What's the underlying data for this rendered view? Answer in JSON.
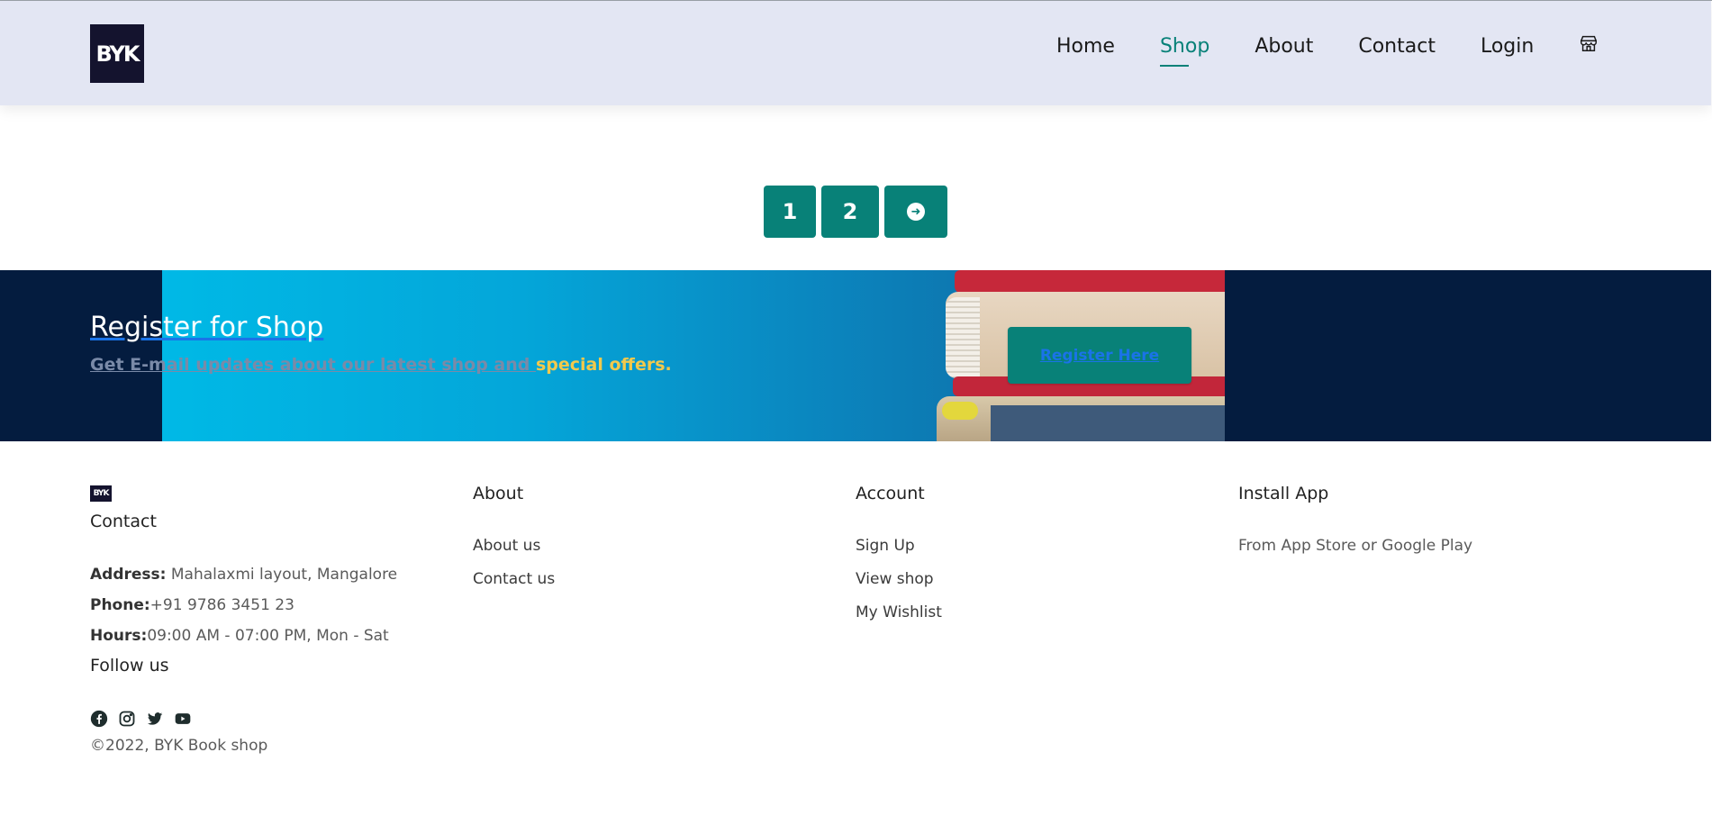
{
  "header": {
    "logo_text": "BYK",
    "nav": [
      {
        "label": "Home"
      },
      {
        "label": "Shop"
      },
      {
        "label": "About"
      },
      {
        "label": "Contact"
      },
      {
        "label": "Login"
      }
    ],
    "bag_icon": "storefront-icon"
  },
  "pagination": {
    "pages": [
      "1",
      "2"
    ],
    "next_icon": "arrow-right-circle-icon"
  },
  "newsletter": {
    "title": "Register for Shop",
    "subtitle_muted": "Get E-mail updates about our latest shop and ",
    "subtitle_accent": "special offers.",
    "button_label": "Register Here"
  },
  "footer": {
    "contact": {
      "logo_text": "BYK",
      "heading": "Contact",
      "address_label": "Address:",
      "address_value": " Mahalaxmi layout, Mangalore",
      "phone_label": "Phone:",
      "phone_value": "+91 9786 3451 23",
      "hours_label": "Hours:",
      "hours_value": "09:00 AM - 07:00 PM, Mon - Sat",
      "follow_heading": "Follow us",
      "socials": [
        "facebook-icon",
        "instagram-icon",
        "twitter-icon",
        "youtube-icon"
      ],
      "copyright": "©2022, BYK Book shop"
    },
    "about": {
      "heading": "About",
      "links": [
        "About us",
        "Contact us"
      ]
    },
    "account": {
      "heading": "Account",
      "links": [
        "Sign Up",
        "View shop",
        "My Wishlist"
      ]
    },
    "install": {
      "heading": "Install App",
      "text": "From App Store or Google Play"
    }
  },
  "colors": {
    "accent": "#088178",
    "header_bg": "#e3e6f3",
    "newsletter_bg": "#041c3f",
    "highlight": "#f2c94c"
  }
}
